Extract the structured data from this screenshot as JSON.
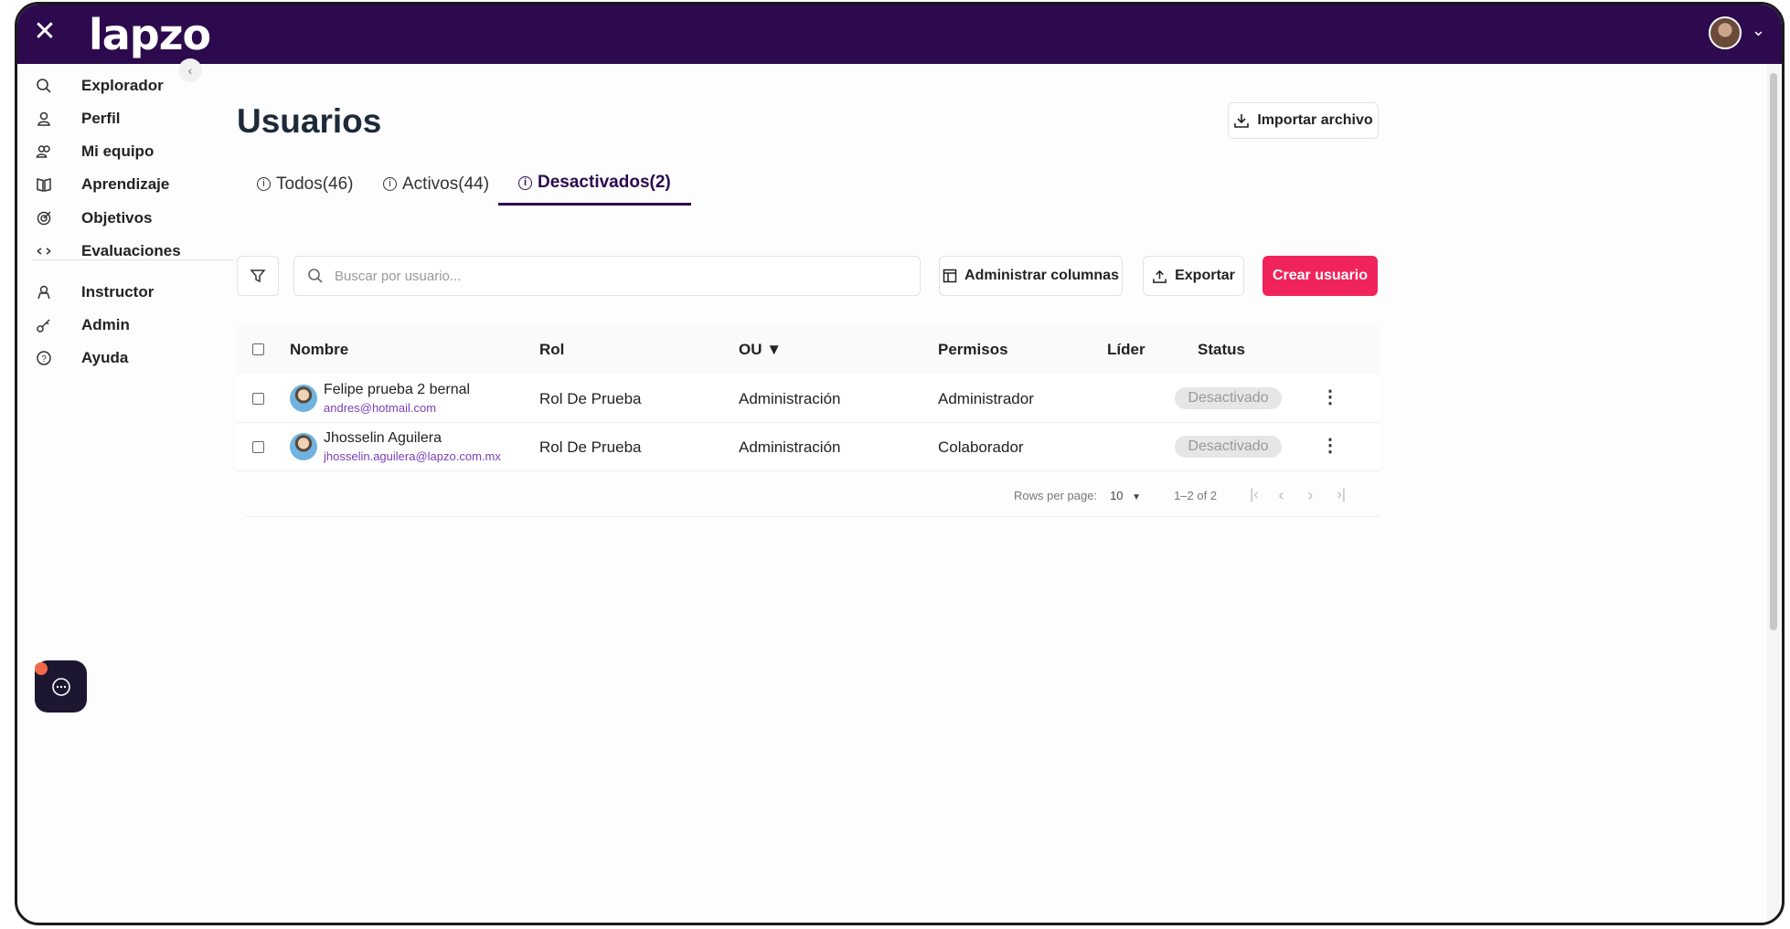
{
  "app": {
    "brand": "lapzo"
  },
  "sidebar": {
    "items": [
      {
        "label": "Explorador",
        "icon": "search-icon"
      },
      {
        "label": "Perfil",
        "icon": "user-icon"
      },
      {
        "label": "Mi equipo",
        "icon": "team-icon"
      },
      {
        "label": "Aprendizaje",
        "icon": "book-icon"
      },
      {
        "label": "Objetivos",
        "icon": "target-icon"
      },
      {
        "label": "Evaluaciones",
        "icon": "evaluation-icon"
      },
      {
        "label": "Instructor",
        "icon": "instructor-icon"
      },
      {
        "label": "Admin",
        "icon": "key-icon"
      },
      {
        "label": "Ayuda",
        "icon": "help-icon"
      }
    ]
  },
  "page": {
    "title": "Usuarios",
    "import_label": "Importar archivo"
  },
  "tabs": [
    {
      "label": "Todos(46)",
      "active": false
    },
    {
      "label": "Activos(44)",
      "active": false
    },
    {
      "label": "Desactivados(2)",
      "active": true
    }
  ],
  "toolbar": {
    "search_placeholder": "Buscar por usuario...",
    "columns_label": "Administrar columnas",
    "export_label": "Exportar",
    "create_label": "Crear usuario"
  },
  "table": {
    "headers": [
      "Nombre",
      "Rol",
      "OU ▼",
      "Permisos",
      "Líder",
      "Status"
    ],
    "rows": [
      {
        "name": "Felipe prueba 2 bernal",
        "email": "andres@hotmail.com",
        "rol": "Rol De Prueba",
        "ou": "Administración",
        "permisos": "Administrador",
        "lider": "",
        "status": "Desactivado"
      },
      {
        "name": "Jhosselin Aguilera",
        "email": "jhosselin.aguilera@lapzo.com.mx",
        "rol": "Rol De Prueba",
        "ou": "Administración",
        "permisos": "Colaborador",
        "lider": "",
        "status": "Desactivado"
      }
    ]
  },
  "pagination": {
    "rows_per_page_label": "Rows per page:",
    "rows_per_page": "10",
    "range": "1–2 of 2"
  },
  "colors": {
    "brand": "#2d0a4e",
    "accent": "#f0245a",
    "email": "#7a3fb8"
  }
}
